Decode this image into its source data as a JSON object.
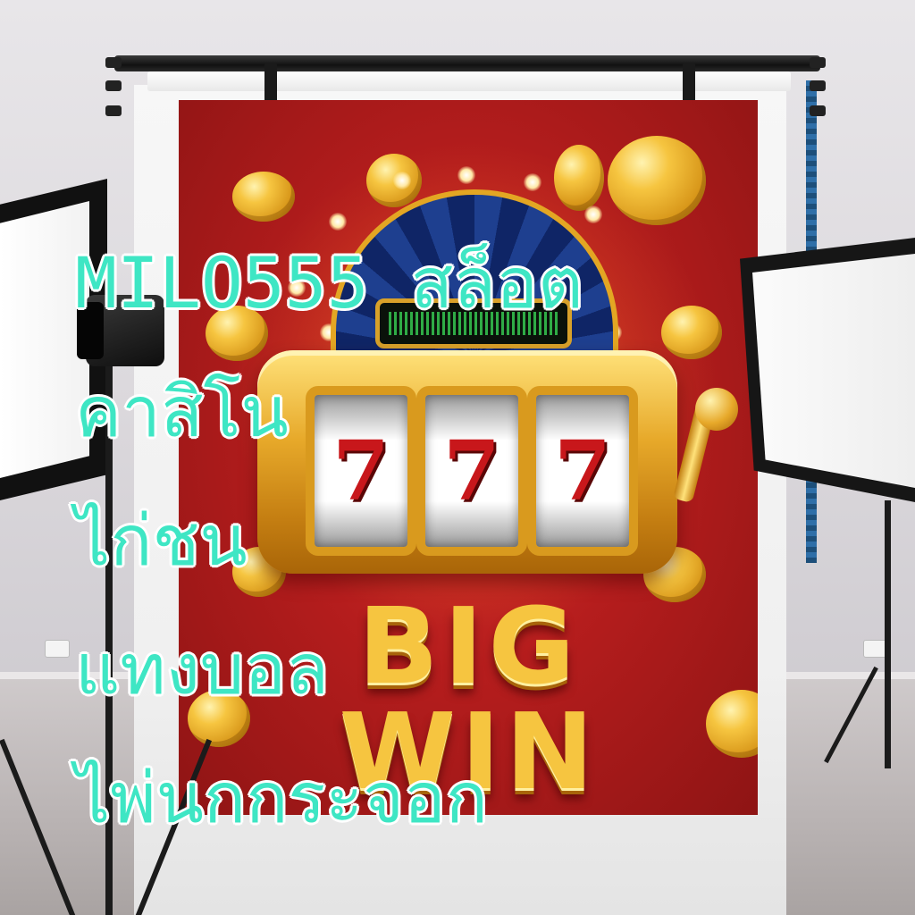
{
  "scene": {
    "banner_text": "BIG WIN",
    "reel_symbols": [
      "7",
      "7",
      "7"
    ],
    "colors": {
      "banner_red": "#b51d1d",
      "gold": "#f6c540",
      "reel_digit": "#c8171b",
      "overlay_text": "#3ee6c4",
      "overlay_outline": "#ffffff",
      "jackpot_led": "#3be05a"
    }
  },
  "overlay": {
    "lines": [
      "MILO555 สล็อต",
      "คาสิโน",
      "ไก่ชน",
      "แทงบอล",
      "ไพ่นกกระจอก"
    ]
  }
}
